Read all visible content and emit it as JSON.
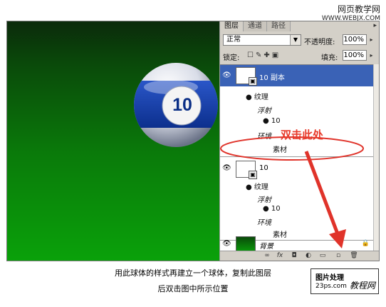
{
  "watermark": {
    "site": "网页教学网",
    "url": "WWW.WEBJX.COM"
  },
  "canvas": {
    "ball_number": "10"
  },
  "layers_panel": {
    "tabs": [
      "图层",
      "通道",
      "路径"
    ],
    "blend_mode": "正常",
    "opacity_label": "不透明度:",
    "opacity_value": "100%",
    "lock_label": "锁定:",
    "fill_label": "填充:",
    "fill_value": "100%",
    "layers": [
      {
        "name": "10 副本",
        "selected": true,
        "effects": {
          "title": "纹理",
          "items": [
            "浮射",
            "10",
            "环境"
          ],
          "extra": "素材"
        }
      },
      {
        "name": "10",
        "selected": false,
        "effects": {
          "title": "纹理",
          "items": [
            "浮射",
            "10",
            "环境"
          ],
          "extra": "素材"
        }
      },
      {
        "name": "背景",
        "selected": false
      }
    ]
  },
  "annotation": {
    "text": "双击此处",
    "color": "#e83a2a"
  },
  "caption": {
    "line1": "用此球体的样式再建立一个球体，复制此图层",
    "line2": "后双击图中所示位置"
  },
  "logo": {
    "line1": "图片处理",
    "line2": "教程网",
    "url": "23ps.com"
  }
}
